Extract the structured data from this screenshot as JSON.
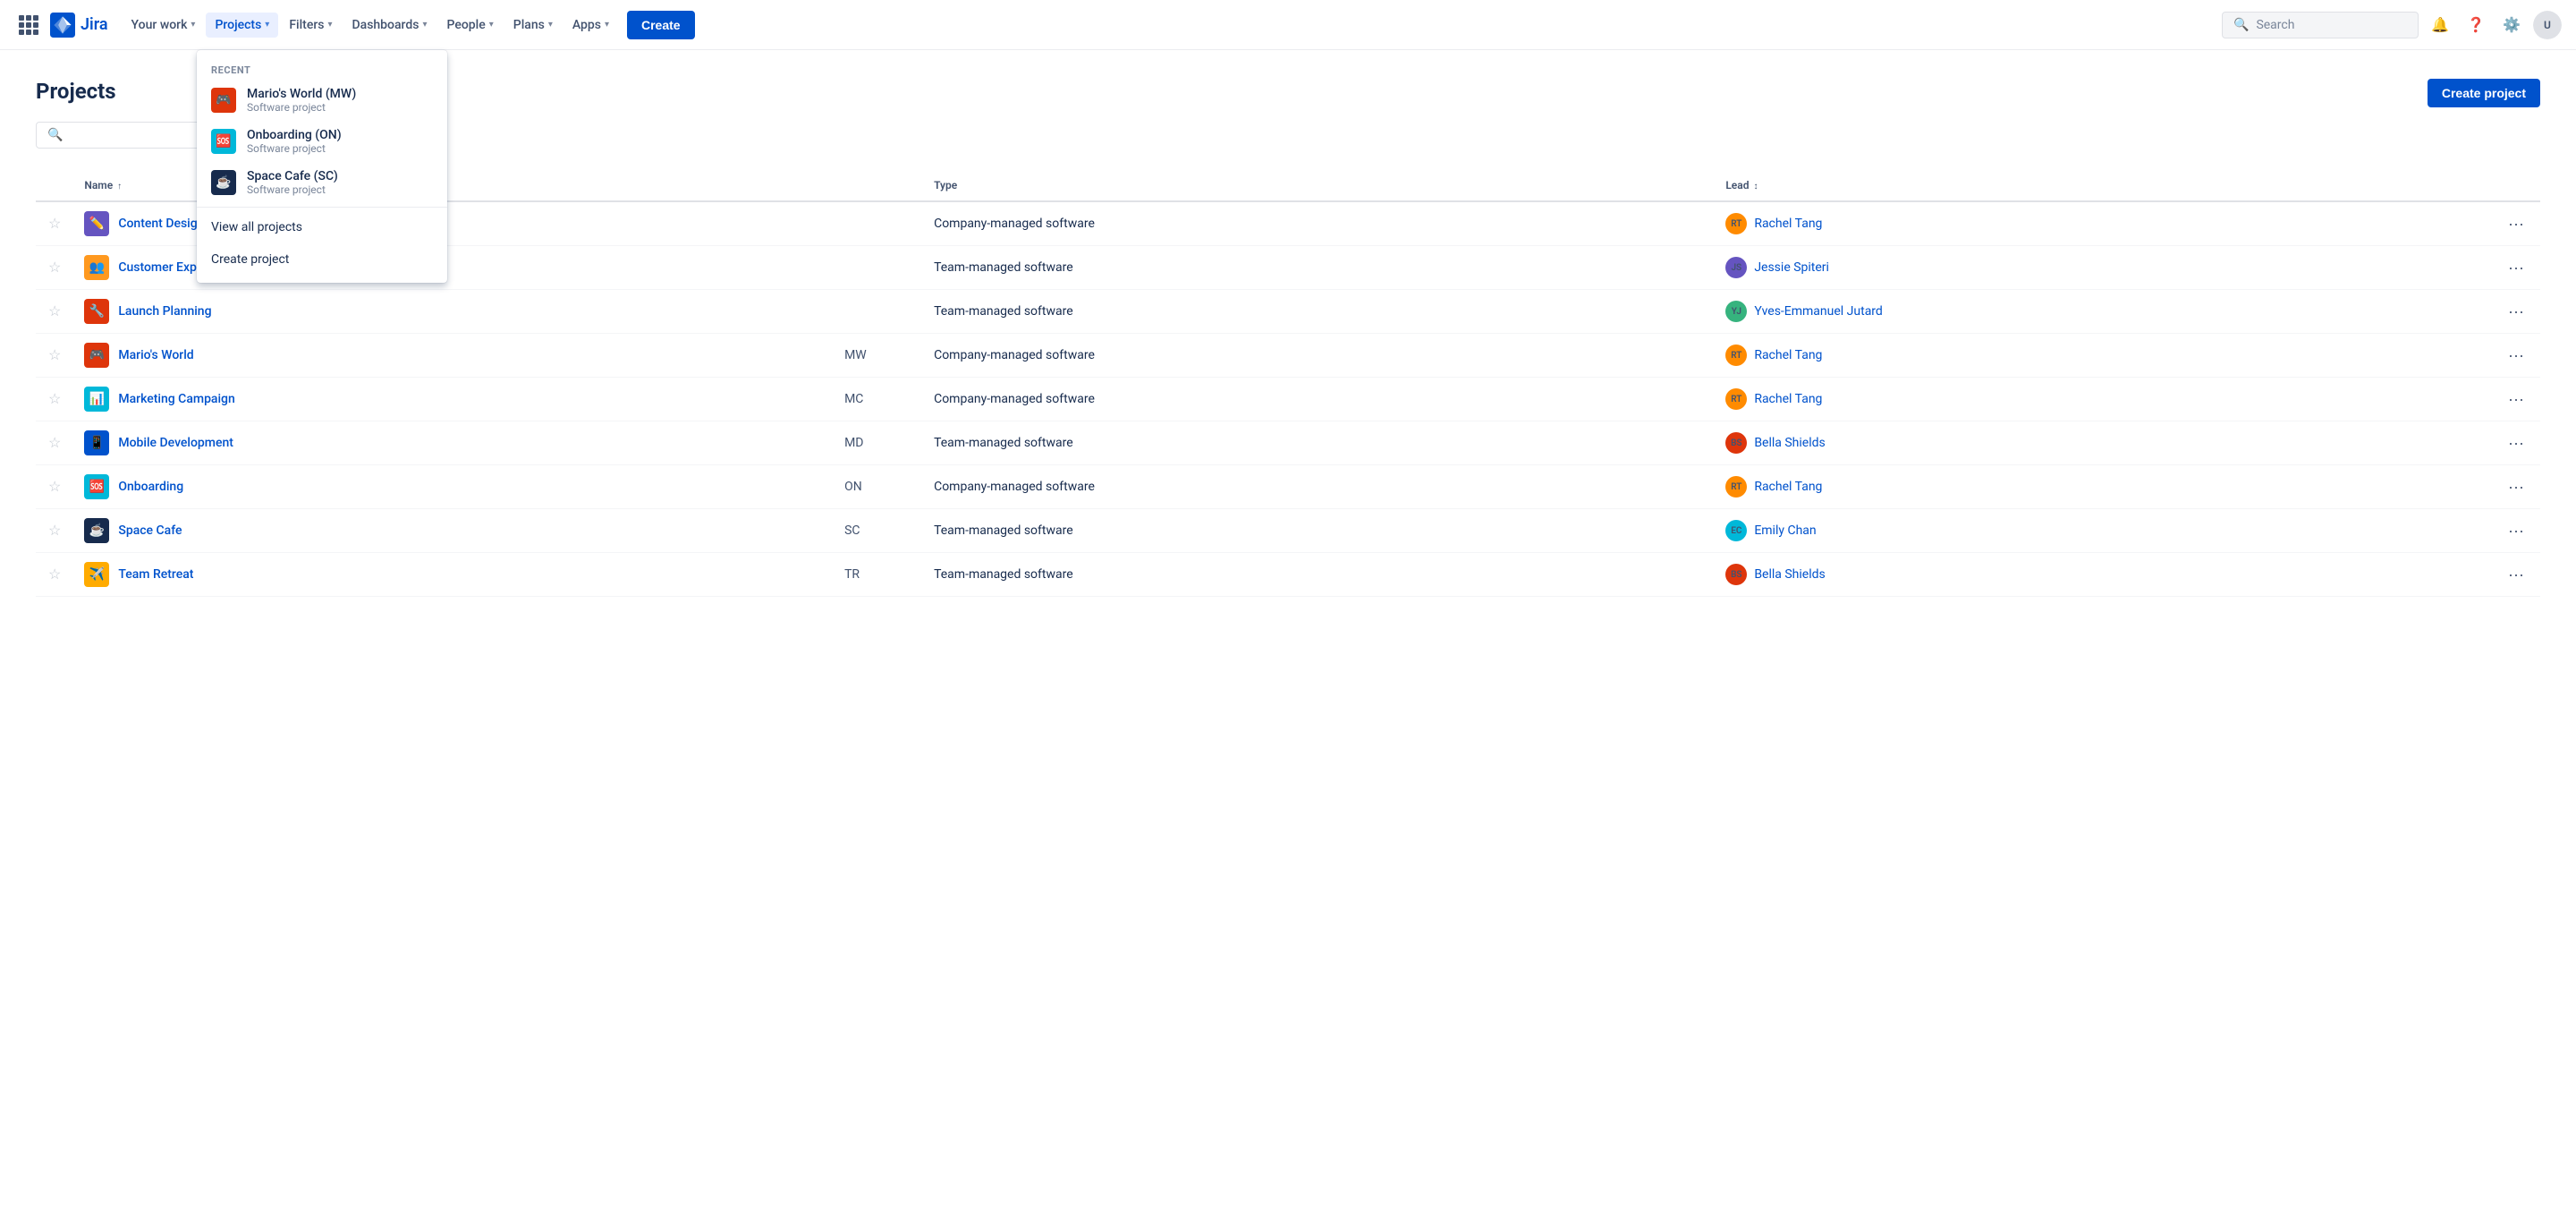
{
  "app": {
    "name": "Jira"
  },
  "navbar": {
    "items": [
      {
        "id": "your-work",
        "label": "Your work",
        "hasDropdown": true,
        "active": false
      },
      {
        "id": "projects",
        "label": "Projects",
        "hasDropdown": true,
        "active": true
      },
      {
        "id": "filters",
        "label": "Filters",
        "hasDropdown": true,
        "active": false
      },
      {
        "id": "dashboards",
        "label": "Dashboards",
        "hasDropdown": true,
        "active": false
      },
      {
        "id": "people",
        "label": "People",
        "hasDropdown": true,
        "active": false
      },
      {
        "id": "plans",
        "label": "Plans",
        "hasDropdown": true,
        "active": false
      },
      {
        "id": "apps",
        "label": "Apps",
        "hasDropdown": true,
        "active": false
      }
    ],
    "create_label": "Create",
    "search_placeholder": "Search"
  },
  "dropdown": {
    "section_label": "RECENT",
    "recent": [
      {
        "id": "mw",
        "name": "Mario's World (MW)",
        "sub": "Software project",
        "icon": "🎮",
        "icon_class": "icon-red"
      },
      {
        "id": "on",
        "name": "Onboarding (ON)",
        "sub": "Software project",
        "icon": "🆘",
        "icon_class": "icon-teal"
      },
      {
        "id": "sc",
        "name": "Space Cafe (SC)",
        "sub": "Software project",
        "icon": "☕",
        "icon_class": "icon-navy"
      }
    ],
    "view_all_label": "View all projects",
    "create_label": "Create project"
  },
  "page": {
    "title": "Projects",
    "create_project_label": "Create project",
    "search_placeholder": ""
  },
  "table": {
    "columns": {
      "star": "",
      "name": "Name",
      "name_sort": "↑",
      "key": "",
      "type": "Type",
      "lead": "Lead",
      "more": ""
    },
    "rows": [
      {
        "id": "cd",
        "star": false,
        "name": "Content Design",
        "key": "",
        "type": "Company-managed software",
        "lead_name": "Rachel Tang",
        "lead_initials": "RT",
        "lead_class": "av-rachel",
        "icon": "✏️",
        "icon_class": "icon-purple"
      },
      {
        "id": "ce",
        "star": false,
        "name": "Customer Experience",
        "key": "",
        "type": "Team-managed software",
        "lead_name": "Jessie Spiteri",
        "lead_initials": "JS",
        "lead_class": "av-jessie",
        "icon": "👥",
        "icon_class": "icon-orange"
      },
      {
        "id": "lp",
        "star": false,
        "name": "Launch Planning",
        "key": "",
        "type": "Team-managed software",
        "lead_name": "Yves-Emmanuel Jutard",
        "lead_initials": "YJ",
        "lead_class": "av-yves",
        "icon": "🔧",
        "icon_class": "icon-red"
      },
      {
        "id": "mw",
        "star": false,
        "name": "Mario's World",
        "key": "MW",
        "type": "Company-managed software",
        "lead_name": "Rachel Tang",
        "lead_initials": "RT",
        "lead_class": "av-rachel",
        "icon": "🎮",
        "icon_class": "icon-red"
      },
      {
        "id": "mc",
        "star": false,
        "name": "Marketing Campaign",
        "key": "MC",
        "type": "Company-managed software",
        "lead_name": "Rachel Tang",
        "lead_initials": "RT",
        "lead_class": "av-rachel",
        "icon": "📊",
        "icon_class": "icon-teal"
      },
      {
        "id": "md",
        "star": false,
        "name": "Mobile Development",
        "key": "MD",
        "type": "Team-managed software",
        "lead_name": "Bella Shields",
        "lead_initials": "BS",
        "lead_class": "av-bella",
        "icon": "📱",
        "icon_class": "icon-blue"
      },
      {
        "id": "on",
        "star": false,
        "name": "Onboarding",
        "key": "ON",
        "type": "Company-managed software",
        "lead_name": "Rachel Tang",
        "lead_initials": "RT",
        "lead_class": "av-rachel",
        "icon": "🆘",
        "icon_class": "icon-teal"
      },
      {
        "id": "sc",
        "star": false,
        "name": "Space Cafe",
        "key": "SC",
        "type": "Team-managed software",
        "lead_name": "Emily Chan",
        "lead_initials": "EC",
        "lead_class": "av-emily",
        "icon": "☕",
        "icon_class": "icon-navy"
      },
      {
        "id": "tr",
        "star": false,
        "name": "Team Retreat",
        "key": "TR",
        "type": "Team-managed software",
        "lead_name": "Bella Shields",
        "lead_initials": "BS",
        "lead_class": "av-bella",
        "icon": "✈️",
        "icon_class": "icon-yellow"
      }
    ]
  }
}
